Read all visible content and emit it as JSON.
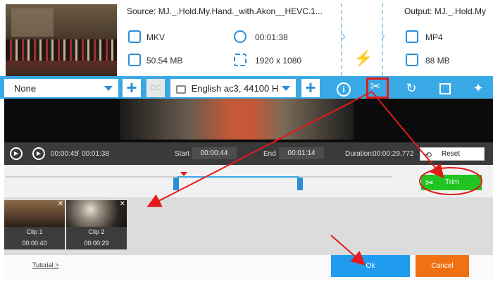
{
  "source": {
    "title": "Source: MJ._.Hold.My.Hand._with.Akon__HEVC.1...",
    "format": "MKV",
    "duration": "00:01:38",
    "size": "50.54 MB",
    "resolution": "1920 x 1080"
  },
  "output": {
    "title": "Output: MJ._.Hold.My",
    "format": "MP4",
    "size": "88 MB"
  },
  "toolbar": {
    "subtitle_select": "None",
    "cc_label": "CC",
    "audio_select": "English ac3, 44100 H",
    "plus_label": "+",
    "info_label": "i"
  },
  "player": {
    "current_time": "00:00:45",
    "time_separator": "/",
    "total_time": "00:01:38",
    "start_label": "Start",
    "start_value": "00:00:44",
    "end_label": "End",
    "end_value": "00:01:14",
    "duration_label": "Duration:",
    "duration_value": "00:00:29.772",
    "reset_label": "Reset"
  },
  "trim": {
    "button_label": "Trim"
  },
  "clips": [
    {
      "name": "Clip 1",
      "duration": "00:00:40"
    },
    {
      "name": "Clip 2",
      "duration": "00:00:29"
    }
  ],
  "footer": {
    "tutorial_link": "Tutorial >",
    "ok_label": "Ok",
    "cancel_label": "Cancel"
  },
  "colors": {
    "accent_blue": "#39a9e6",
    "trim_green": "#21c421",
    "ok_blue": "#1f9bef",
    "cancel_orange": "#f07014",
    "annotation_red": "#e21a1a"
  }
}
